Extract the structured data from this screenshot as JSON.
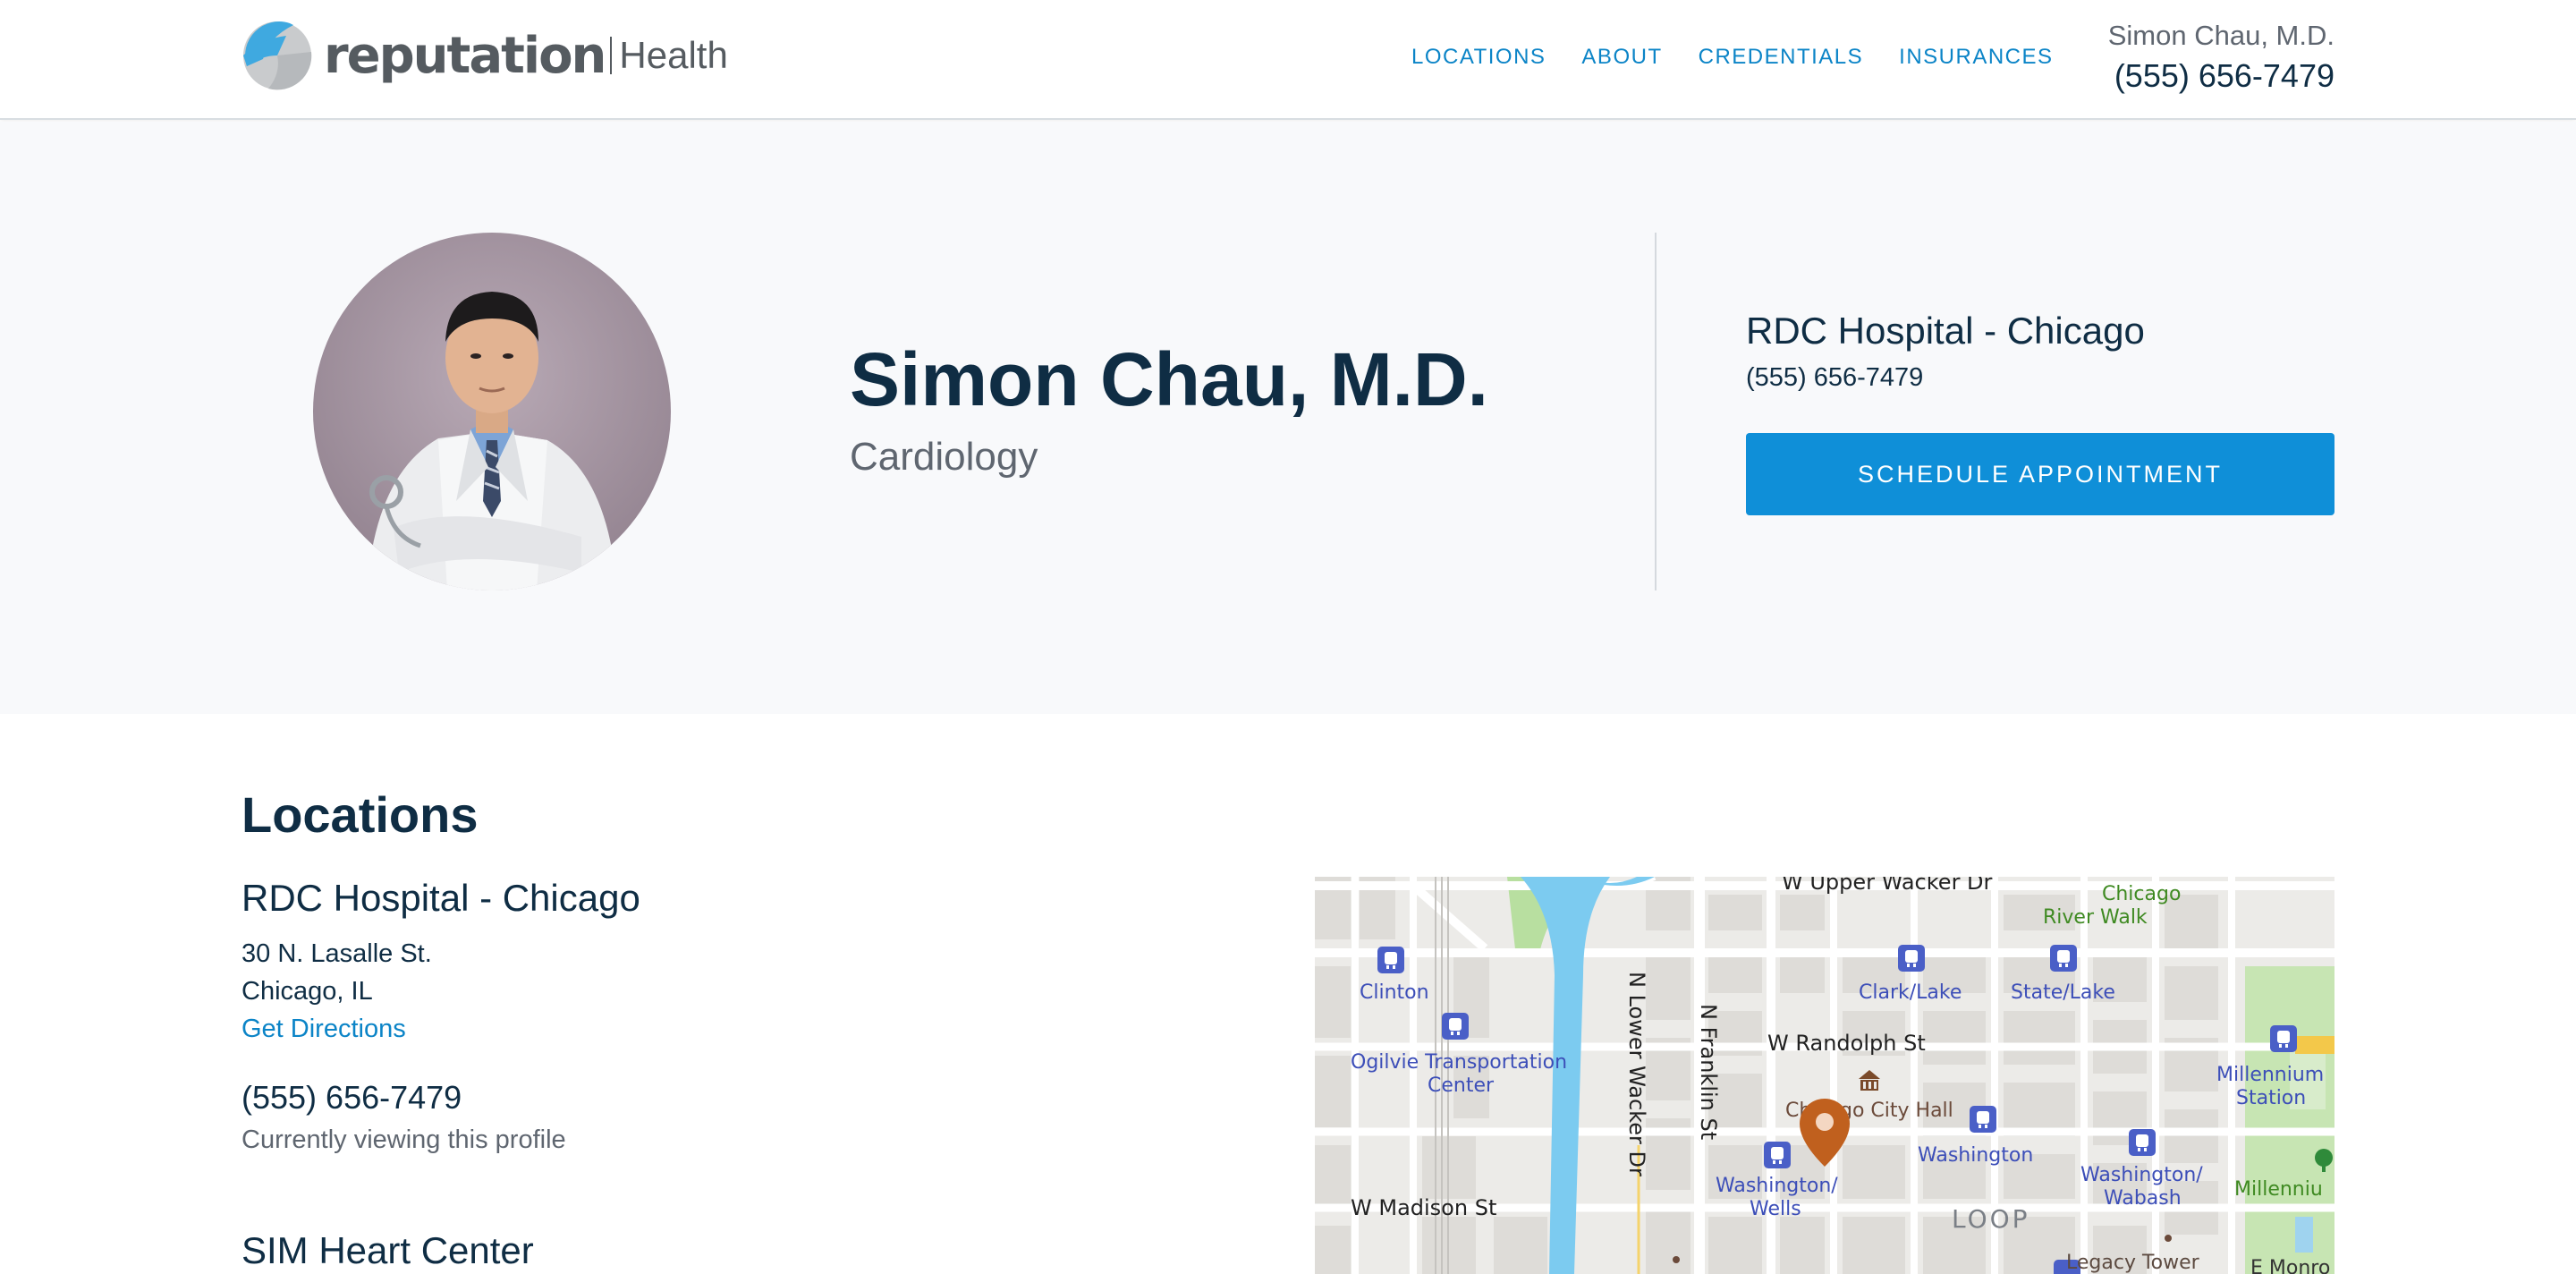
{
  "header": {
    "logo_word": "reputation",
    "logo_sub": "Health",
    "nav": [
      "LOCATIONS",
      "ABOUT",
      "CREDENTIALS",
      "INSURANCES"
    ],
    "contact_name": "Simon Chau, M.D.",
    "contact_phone": "(555) 656-7479"
  },
  "hero": {
    "name": "Simon Chau, M.D.",
    "specialty": "Cardiology",
    "location_name": "RDC Hospital - Chicago",
    "location_phone": "(555) 656-7479",
    "schedule_label": "SCHEDULE APPOINTMENT"
  },
  "locations": {
    "heading": "Locations",
    "items": [
      {
        "name": "RDC Hospital - Chicago",
        "address_line1": "30 N. Lasalle St.",
        "address_line2": "Chicago, IL",
        "directions_label": "Get Directions",
        "phone": "(555) 656-7479",
        "note": "Currently viewing this profile"
      },
      {
        "name": "SIM Heart Center"
      }
    ]
  },
  "map": {
    "labels": {
      "upper_wacker": "W Upper Wacker Dr",
      "river_walk_1": "Chicago",
      "river_walk_2": "River Walk",
      "clinton": "Clinton",
      "clark_lake": "Clark/Lake",
      "state_lake": "State/Lake",
      "ogilvie_1": "Ogilvie Transportation",
      "ogilvie_2": "Center",
      "lower_wacker": "N Lower Wacker Dr",
      "franklin": "N Franklin St",
      "randolph": "W Randolph St",
      "millennium_station_1": "Millennium",
      "millennium_station_2": "Station",
      "city_hall": "Chicago City Hall",
      "washington": "Washington",
      "washington_wells_1": "Washington/",
      "washington_wells_2": "Wells",
      "washington_wabash_1": "Washington/",
      "washington_wabash_2": "Wabash",
      "millennium_park": "Millenniu",
      "madison": "W Madison St",
      "loop": "LOOP",
      "legacy_tower": "Legacy Tower",
      "e_monroe": "E Monro"
    },
    "colors": {
      "land": "#ecebe8",
      "block": "#dedcd8",
      "road": "#ffffff",
      "river": "#7ccbf0",
      "park": "#c7e5b3",
      "transit": "#4a5fc7",
      "pin": "#c0601e"
    }
  }
}
